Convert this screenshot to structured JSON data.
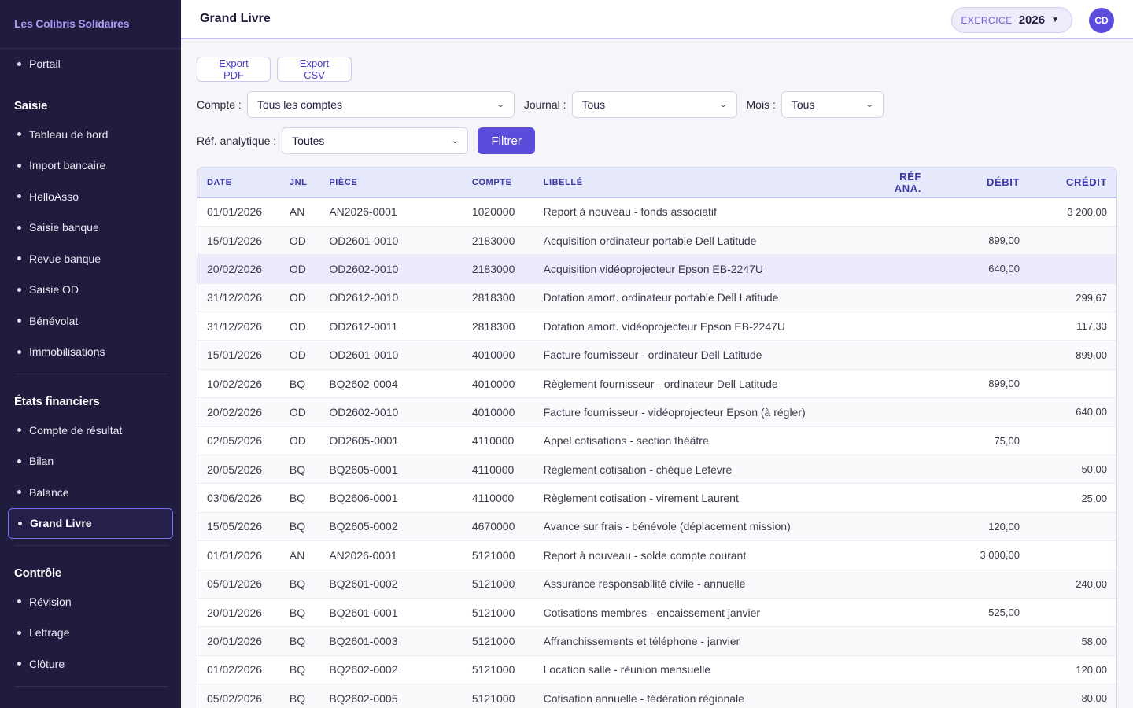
{
  "sidebar": {
    "brand": "Les Colibris Solidaires",
    "portail": "Portail",
    "saisie": {
      "title": "Saisie",
      "items": [
        "Tableau de bord",
        "Import bancaire",
        "HelloAsso",
        "Saisie banque",
        "Revue banque",
        "Saisie OD",
        "Bénévolat",
        "Immobilisations"
      ]
    },
    "etats": {
      "title": "États financiers",
      "items": [
        "Compte de résultat",
        "Bilan",
        "Balance",
        "Grand Livre"
      ],
      "active": "Grand Livre"
    },
    "controle": {
      "title": "Contrôle",
      "items": [
        "Révision",
        "Lettrage",
        "Clôture"
      ]
    }
  },
  "header": {
    "title": "Grand Livre",
    "exercice_label": "EXERCICE",
    "exercice_year": "2026",
    "avatar": "CD"
  },
  "toolbar": {
    "export_pdf": "Export PDF",
    "export_csv": "Export CSV"
  },
  "filters": {
    "compte_label": "Compte :",
    "compte_value": "Tous les comptes",
    "journal_label": "Journal :",
    "journal_value": "Tous",
    "mois_label": "Mois :",
    "mois_value": "Tous",
    "ref_label": "Réf. analytique :",
    "ref_value": "Toutes",
    "filtrer": "Filtrer"
  },
  "table": {
    "headers": [
      "DATE",
      "JNL",
      "PIÈCE",
      "COMPTE",
      "LIBELLÉ",
      "RÉF ANA.",
      "DÉBIT",
      "CRÉDIT"
    ],
    "rows": [
      [
        "01/01/2026",
        "AN",
        "AN2026-0001",
        "1020000",
        "Report à nouveau - fonds associatif",
        "",
        "",
        "3 200,00"
      ],
      [
        "15/01/2026",
        "OD",
        "OD2601-0010",
        "2183000",
        "Acquisition ordinateur portable Dell Latitude",
        "",
        "899,00",
        ""
      ],
      [
        "20/02/2026",
        "OD",
        "OD2602-0010",
        "2183000",
        "Acquisition vidéoprojecteur Epson EB-2247U",
        "",
        "640,00",
        ""
      ],
      [
        "31/12/2026",
        "OD",
        "OD2612-0010",
        "2818300",
        "Dotation amort. ordinateur portable Dell Latitude",
        "",
        "",
        "299,67"
      ],
      [
        "31/12/2026",
        "OD",
        "OD2612-0011",
        "2818300",
        "Dotation amort. vidéoprojecteur Epson EB-2247U",
        "",
        "",
        "117,33"
      ],
      [
        "15/01/2026",
        "OD",
        "OD2601-0010",
        "4010000",
        "Facture fournisseur - ordinateur Dell Latitude",
        "",
        "",
        "899,00"
      ],
      [
        "10/02/2026",
        "BQ",
        "BQ2602-0004",
        "4010000",
        "Règlement fournisseur - ordinateur Dell Latitude",
        "",
        "899,00",
        ""
      ],
      [
        "20/02/2026",
        "OD",
        "OD2602-0010",
        "4010000",
        "Facture fournisseur - vidéoprojecteur Epson (à régler)",
        "",
        "",
        "640,00"
      ],
      [
        "02/05/2026",
        "OD",
        "OD2605-0001",
        "4110000",
        "Appel cotisations - section théâtre",
        "",
        "75,00",
        ""
      ],
      [
        "20/05/2026",
        "BQ",
        "BQ2605-0001",
        "4110000",
        "Règlement cotisation - chèque Lefèvre",
        "",
        "",
        "50,00"
      ],
      [
        "03/06/2026",
        "BQ",
        "BQ2606-0001",
        "4110000",
        "Règlement cotisation - virement Laurent",
        "",
        "",
        "25,00"
      ],
      [
        "15/05/2026",
        "BQ",
        "BQ2605-0002",
        "4670000",
        "Avance sur frais - bénévole (déplacement mission)",
        "",
        "120,00",
        ""
      ],
      [
        "01/01/2026",
        "AN",
        "AN2026-0001",
        "5121000",
        "Report à nouveau - solde compte courant",
        "",
        "3 000,00",
        ""
      ],
      [
        "05/01/2026",
        "BQ",
        "BQ2601-0002",
        "5121000",
        "Assurance responsabilité civile - annuelle",
        "",
        "",
        "240,00"
      ],
      [
        "20/01/2026",
        "BQ",
        "BQ2601-0001",
        "5121000",
        "Cotisations membres - encaissement janvier",
        "",
        "525,00",
        ""
      ],
      [
        "20/01/2026",
        "BQ",
        "BQ2601-0003",
        "5121000",
        "Affranchissements et téléphone - janvier",
        "",
        "",
        "58,00"
      ],
      [
        "01/02/2026",
        "BQ",
        "BQ2602-0002",
        "5121000",
        "Location salle - réunion mensuelle",
        "",
        "",
        "120,00"
      ],
      [
        "05/02/2026",
        "BQ",
        "BQ2602-0005",
        "5121000",
        "Cotisation annuelle - fédération régionale",
        "",
        "",
        "80,00"
      ]
    ]
  }
}
